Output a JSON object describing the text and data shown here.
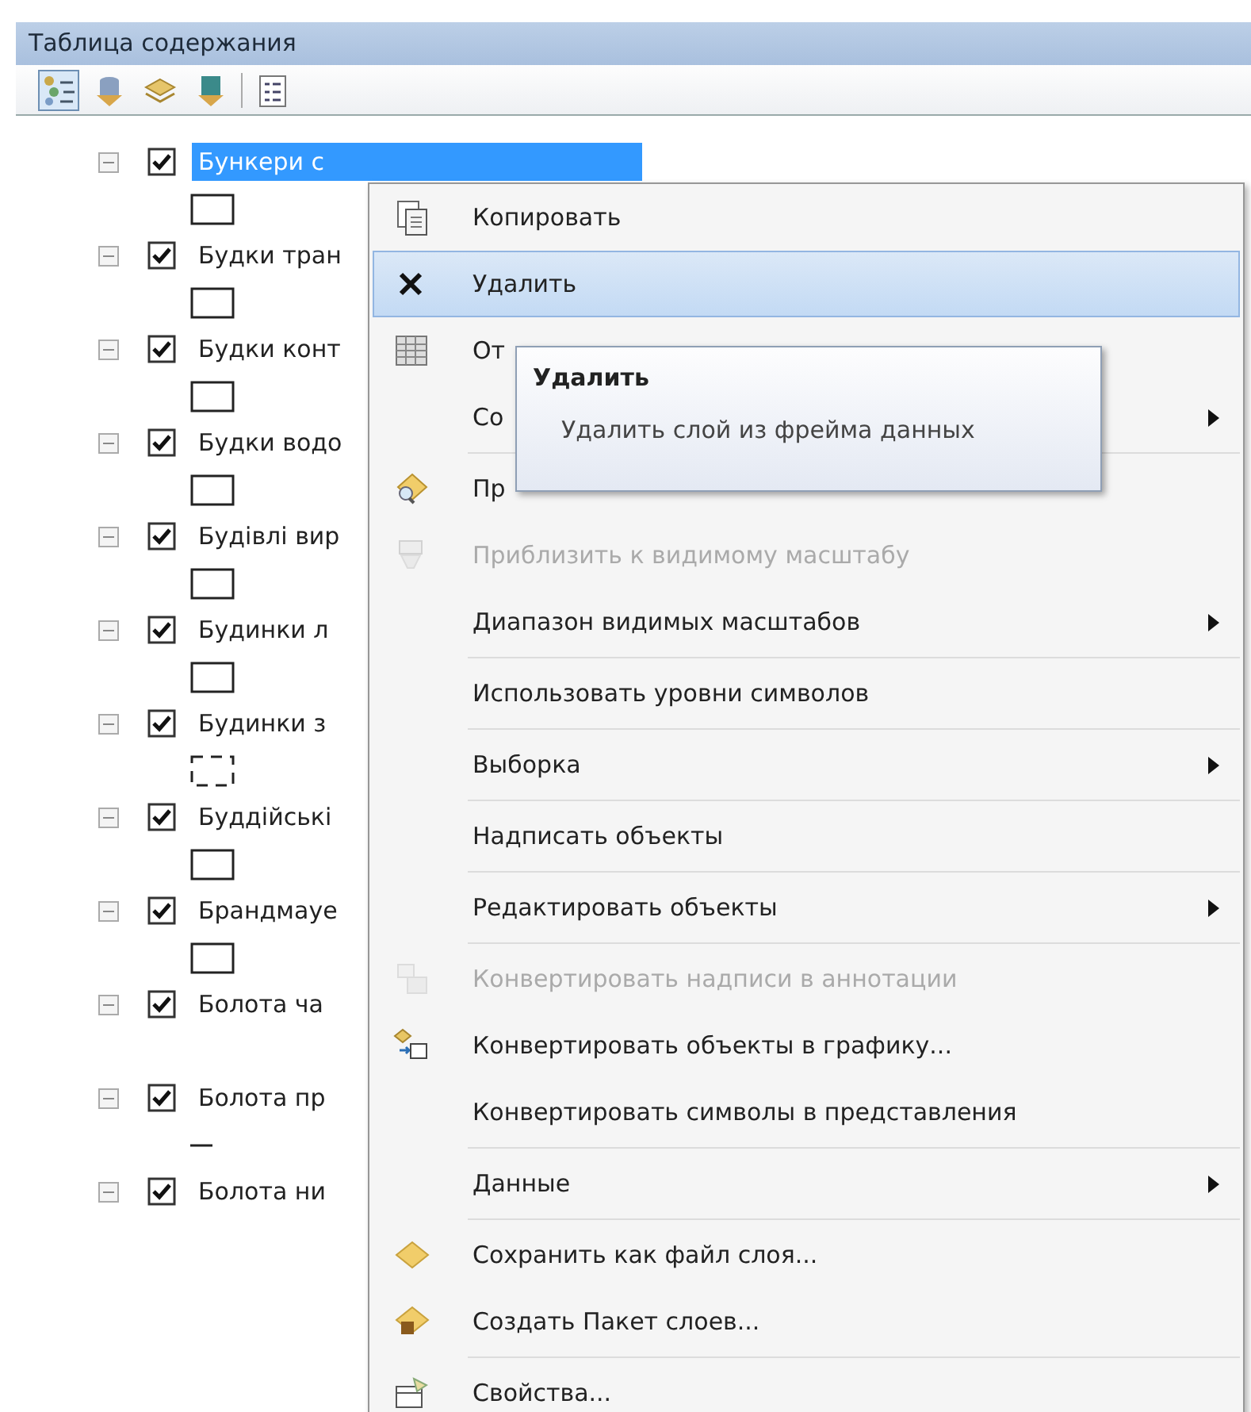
{
  "panel": {
    "title": "Таблица содержания"
  },
  "toolbar": [
    {
      "selected": true
    },
    {
      "selected": false
    },
    {
      "selected": false
    },
    {
      "selected": false
    },
    {
      "selected": false
    }
  ],
  "layers": [
    {
      "name": "Бункери с",
      "checked": true,
      "selected": true,
      "kind": "polygon"
    },
    {
      "name": "Будки тран",
      "checked": true,
      "selected": false,
      "kind": "polygon"
    },
    {
      "name": "Будки конт",
      "checked": true,
      "selected": false,
      "kind": "polygon"
    },
    {
      "name": "Будки водо",
      "checked": true,
      "selected": false,
      "kind": "polygon"
    },
    {
      "name": "Будівлі вир",
      "checked": true,
      "selected": false,
      "kind": "polygon"
    },
    {
      "name": "Будинки л",
      "checked": true,
      "selected": false,
      "kind": "polygon"
    },
    {
      "name": "Будинки з",
      "checked": true,
      "selected": false,
      "kind": "dashed"
    },
    {
      "name": "Буддійські",
      "checked": true,
      "selected": false,
      "kind": "polygon"
    },
    {
      "name": "Брандмауе",
      "checked": true,
      "selected": false,
      "kind": "polygon"
    },
    {
      "name": "Болота ча",
      "checked": true,
      "selected": false,
      "kind": "unsymbolized"
    },
    {
      "name": "Болота пр",
      "checked": true,
      "selected": false,
      "kind": "line"
    },
    {
      "name": "Болота ни",
      "checked": true,
      "selected": false,
      "kind": "unsymbolized"
    }
  ],
  "context_menu": [
    {
      "kind": "item",
      "label": "Копировать",
      "disabled": false,
      "selected": false,
      "submenu": false
    },
    {
      "kind": "item",
      "label": "Удалить",
      "disabled": false,
      "selected": true,
      "submenu": false
    },
    {
      "kind": "item",
      "label": "От",
      "disabled": false,
      "selected": false,
      "submenu": false
    },
    {
      "kind": "item",
      "label": "Со",
      "disabled": false,
      "selected": false,
      "submenu": true
    },
    {
      "kind": "separator"
    },
    {
      "kind": "item",
      "label": "Пр",
      "disabled": false,
      "selected": false,
      "submenu": false
    },
    {
      "kind": "item",
      "label": "Приблизить к видимому масштабу",
      "disabled": true,
      "selected": false,
      "submenu": false
    },
    {
      "kind": "item",
      "label": "Диапазон видимых масштабов",
      "disabled": false,
      "selected": false,
      "submenu": true
    },
    {
      "kind": "separator"
    },
    {
      "kind": "item",
      "label": "Использовать уровни символов",
      "disabled": false,
      "selected": false,
      "submenu": false
    },
    {
      "kind": "separator"
    },
    {
      "kind": "item",
      "label": "Выборка",
      "disabled": false,
      "selected": false,
      "submenu": true
    },
    {
      "kind": "separator"
    },
    {
      "kind": "item",
      "label": "Надписать объекты",
      "disabled": false,
      "selected": false,
      "submenu": false
    },
    {
      "kind": "separator"
    },
    {
      "kind": "item",
      "label": "Редактировать объекты",
      "disabled": false,
      "selected": false,
      "submenu": true
    },
    {
      "kind": "separator"
    },
    {
      "kind": "item",
      "label": "Конвертировать надписи в аннотации",
      "disabled": true,
      "selected": false,
      "submenu": false
    },
    {
      "kind": "item",
      "label": "Конвертировать объекты в графику...",
      "disabled": false,
      "selected": false,
      "submenu": false
    },
    {
      "kind": "item",
      "label": "Конвертировать символы в представления",
      "disabled": false,
      "selected": false,
      "submenu": false
    },
    {
      "kind": "separator"
    },
    {
      "kind": "item",
      "label": "Данные",
      "disabled": false,
      "selected": false,
      "submenu": true
    },
    {
      "kind": "separator"
    },
    {
      "kind": "item",
      "label": "Сохранить как файл слоя...",
      "disabled": false,
      "selected": false,
      "submenu": false
    },
    {
      "kind": "item",
      "label": "Создать Пакет слоев...",
      "disabled": false,
      "selected": false,
      "submenu": false
    },
    {
      "kind": "separator"
    },
    {
      "kind": "item",
      "label": "Свойства...",
      "disabled": false,
      "selected": false,
      "submenu": false
    }
  ],
  "tooltip": {
    "title": "Удалить",
    "description": "Удалить слой из фрейма данных"
  }
}
